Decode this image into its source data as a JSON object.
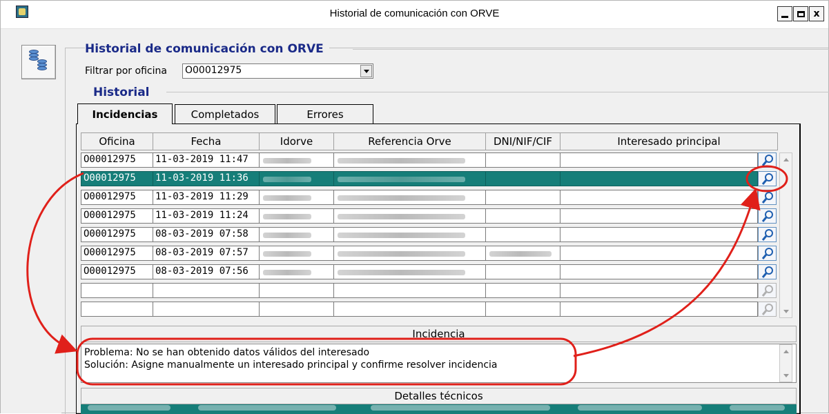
{
  "window": {
    "title": "Historial de comunicación con ORVE",
    "minimize_label": "minimize",
    "maximize_label": "maximize",
    "close_label": "x"
  },
  "header": {
    "group_title": "Historial de comunicación con ORVE",
    "filter_label": "Filtrar por oficina",
    "filter_value": "O00012975"
  },
  "historial": {
    "title": "Historial",
    "tabs": [
      {
        "label": "Incidencias",
        "active": true
      },
      {
        "label": "Completados",
        "active": false
      },
      {
        "label": "Errores",
        "active": false
      }
    ]
  },
  "grid": {
    "columns": [
      "Oficina",
      "Fecha",
      "Idorve",
      "Referencia Orve",
      "DNI/NIF/CIF",
      "Interesado principal"
    ],
    "rows": [
      {
        "oficina": "O00012975",
        "fecha": "11-03-2019 11:47",
        "selected": false
      },
      {
        "oficina": "O00012975",
        "fecha": "11-03-2019 11:36",
        "selected": true
      },
      {
        "oficina": "O00012975",
        "fecha": "11-03-2019 11:29",
        "selected": false
      },
      {
        "oficina": "O00012975",
        "fecha": "11-03-2019 11:24",
        "selected": false
      },
      {
        "oficina": "O00012975",
        "fecha": "08-03-2019 07:58",
        "selected": false
      },
      {
        "oficina": "O00012975",
        "fecha": "08-03-2019 07:57",
        "selected": false
      },
      {
        "oficina": "O00012975",
        "fecha": "08-03-2019 07:56",
        "selected": false
      },
      {
        "oficina": "",
        "fecha": "",
        "selected": false
      },
      {
        "oficina": "",
        "fecha": "",
        "selected": false
      }
    ]
  },
  "incidencia": {
    "title": "Incidencia",
    "problema": "Problema: No se han obtenido datos válidos del interesado",
    "solucion": "Solución: Asigne manualmente un interesado principal y confirme resolver incidencia"
  },
  "detalles": {
    "title": "Detalles técnicos"
  },
  "colors": {
    "selection": "#167e79",
    "heading": "#1a2a88",
    "annotation": "#e0201a"
  },
  "icons": {
    "row_action": "magnifier-icon",
    "side_tool": "database-icon",
    "app": "app-icon"
  }
}
